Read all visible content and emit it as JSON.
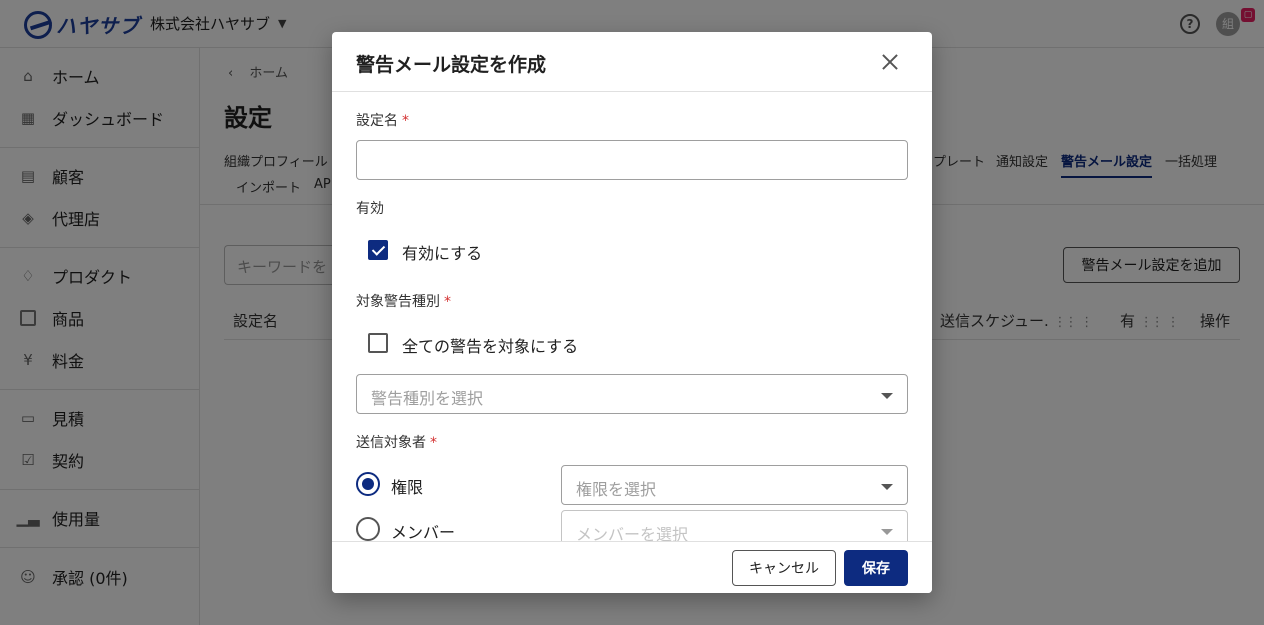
{
  "header": {
    "logo_text": "ハヤサブ",
    "org_name": "株式会社ハヤサブ",
    "avatar_initial": "組",
    "help_glyph": "?"
  },
  "sidebar": {
    "items": [
      {
        "label": "ホーム",
        "icon": "home-icon"
      },
      {
        "label": "ダッシュボード",
        "icon": "dashboard-icon"
      },
      {
        "label": "顧客",
        "icon": "customer-icon"
      },
      {
        "label": "代理店",
        "icon": "agency-icon"
      },
      {
        "label": "プロダクト",
        "icon": "product-icon"
      },
      {
        "label": "商品",
        "icon": "goods-icon"
      },
      {
        "label": "料金",
        "icon": "yen-icon"
      },
      {
        "label": "見積",
        "icon": "quote-icon"
      },
      {
        "label": "契約",
        "icon": "contract-icon"
      },
      {
        "label": "使用量",
        "icon": "usage-icon"
      },
      {
        "label": "承認 (0件)",
        "icon": "approval-icon"
      }
    ]
  },
  "main": {
    "breadcrumb": "ホーム",
    "page_title": "設定",
    "tabs_row1": [
      "組織プロフィール",
      "プレート",
      "通知設定",
      "警告メール設定",
      "一括処理"
    ],
    "tabs_row2": [
      "インポート",
      "AP"
    ],
    "active_tab": "警告メール設定",
    "search_placeholder": "キーワードを",
    "add_button": "警告メール設定を追加",
    "columns": [
      "設定名",
      "送信スケジュー.",
      "有",
      "操作"
    ]
  },
  "modal": {
    "title": "警告メール設定を作成",
    "name_label": "設定名",
    "required_mark": "*",
    "enabled_label": "有効",
    "enabled_checkbox": "有効にする",
    "alert_type_label": "対象警告種別",
    "all_alerts_checkbox": "全ての警告を対象にする",
    "alert_type_placeholder": "警告種別を選択",
    "recipients_label": "送信対象者",
    "role_radio": "権限",
    "role_placeholder": "権限を選択",
    "member_radio": "メンバー",
    "member_placeholder": "メンバーを選択",
    "cancel": "キャンセル",
    "save": "保存"
  },
  "colors": {
    "primary": "#0d2b80",
    "required": "#d32f2f"
  }
}
